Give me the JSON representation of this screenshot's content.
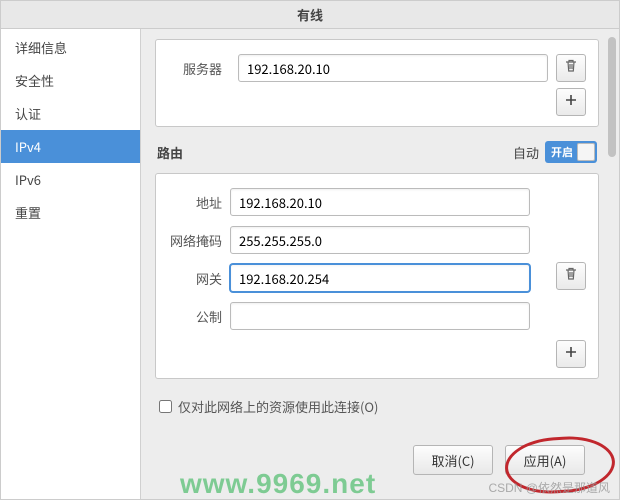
{
  "window": {
    "title": "有线"
  },
  "sidebar": {
    "items": [
      {
        "label": "详细信息"
      },
      {
        "label": "安全性"
      },
      {
        "label": "认证"
      },
      {
        "label": "IPv4",
        "selected": true
      },
      {
        "label": "IPv6"
      },
      {
        "label": "重置"
      }
    ]
  },
  "dns": {
    "server_label": "服务器",
    "server_value": "192.168.20.10",
    "trash_icon": "trash-icon",
    "add_icon": "plus-icon"
  },
  "routes": {
    "heading": "路由",
    "auto_label": "自动",
    "switch_text": "开启",
    "switch_state": "on",
    "fields": {
      "address": {
        "label": "地址",
        "value": "192.168.20.10"
      },
      "netmask": {
        "label": "网络掩码",
        "value": "255.255.255.0"
      },
      "gateway": {
        "label": "网关",
        "value": "192.168.20.254"
      },
      "metric": {
        "label": "公制",
        "value": ""
      }
    },
    "trash_icon": "trash-icon",
    "add_icon": "plus-icon"
  },
  "option": {
    "restrict_label": "仅对此网络上的资源使用此连接(O)",
    "restrict_checked": false
  },
  "footer": {
    "cancel": "取消(C)",
    "apply": "应用(A)"
  },
  "watermarks": {
    "green": "www.9969.net",
    "grey": "CSDN @依然是那道风"
  }
}
